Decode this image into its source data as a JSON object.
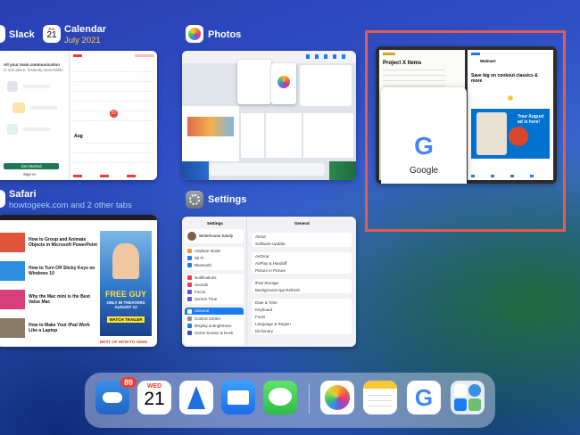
{
  "slack": {
    "name": "Slack",
    "headline": "All your team communication",
    "sub": "in one place, instantly searchable.",
    "cta": "Get Started",
    "signin": "Sign In"
  },
  "calendar": {
    "name": "Calendar",
    "icon_month": "JUL",
    "icon_day": "21",
    "subtitle": "July 2021",
    "month_label": "Aug",
    "selected_day": "21"
  },
  "photos": {
    "name": "Photos"
  },
  "settings": {
    "name": "Settings",
    "panel_title": "Settings",
    "detail_title": "General",
    "user_name": "Writerhouse Sandy",
    "items": [
      "Airplane Mode",
      "Wi-Fi",
      "Bluetooth",
      "Notifications",
      "Sounds",
      "Focus",
      "Screen Time",
      "General",
      "Control Center",
      "Display & Brightness",
      "Home Screen & Dock"
    ],
    "general_items": [
      "About",
      "Software Update",
      "AirDrop",
      "AirPlay & Handoff",
      "Picture in Picture",
      "iPad Storage",
      "Background App Refresh",
      "Date & Time",
      "Keyboard",
      "Fonts",
      "Language & Region",
      "Dictionary"
    ]
  },
  "safari": {
    "name": "Safari",
    "subtitle": "howtogeek.com and 2 other tabs",
    "articles": [
      "How to Group and Animate Objects in Microsoft PowerPoint",
      "How to Turn Off Sticky Keys on Windows 10",
      "Why the Mac mini is the Best Value Mac",
      "How to Make Your iPad Work Like a Laptop"
    ],
    "poster_title": "FREE GUY",
    "poster_sub": "ONLY IN THEATERS AUGUST 13",
    "poster_cta": "WATCH TRAILER",
    "section": "BEST OF HOW-TO GEEK"
  },
  "splitview": {
    "notes_title": "Project X Items",
    "google_label": "Google",
    "mail_header": "Walmart",
    "mail_subject": "Save big on cookout classics & more",
    "mail_promo": "Your August ad is here!"
  },
  "dock": {
    "weather_badge": "89",
    "calendar_day": "WED",
    "calendar_date": "21"
  },
  "colors": {
    "highlight": "#e85a4f",
    "accent_blue": "#1a7cf5",
    "calendar_red": "#f23b30"
  }
}
